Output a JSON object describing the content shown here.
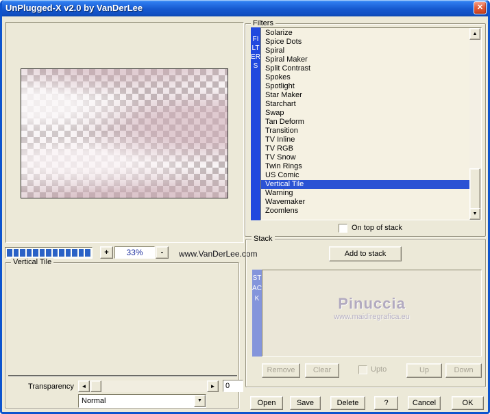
{
  "window": {
    "title": "UnPlugged-X v2.0 by VanDerLee"
  },
  "icons": {
    "close": "✕",
    "up_arrow": "▲",
    "down_arrow": "▼",
    "left_arrow": "◄",
    "right_arrow": "►"
  },
  "zoom_controls": {
    "plus_label": "+",
    "value": "33%",
    "minus_label": "-"
  },
  "progress": {
    "segments": 13
  },
  "branding": {
    "website": "www.VanDerLee.com"
  },
  "vt_group": {
    "label": "Vertical Tile",
    "transparency_label": "Transparency",
    "transparency_value": "0",
    "blend_mode": "Normal"
  },
  "filters": {
    "label": "Filters",
    "vertical_label": "FILTERS",
    "items": [
      "Solarize",
      "Spice Dots",
      "Spiral",
      "Spiral Maker",
      "Split Contrast",
      "Spokes",
      "Spotlight",
      "Star Maker",
      "Starchart",
      "Swap",
      "Tan Deform",
      "Transition",
      "TV Inline",
      "TV RGB",
      "TV Snow",
      "Twin Rings",
      "US Comic",
      "Vertical Tile",
      "Warning",
      "Wavemaker",
      "Zoomlens"
    ],
    "selected": "Vertical Tile",
    "on_top_label": "On top of stack",
    "on_top_checked": false
  },
  "stack": {
    "label": "Stack",
    "vertical_label": "STACK",
    "add_button": "Add to stack",
    "watermark_title": "Pinuccia",
    "watermark_url": "www.maidiregrafica.eu",
    "remove_button": "Remove",
    "clear_button": "Clear",
    "upto_label": "Upto",
    "upto_checked": false,
    "up_button": "Up",
    "down_button": "Down"
  },
  "footer": {
    "open": "Open",
    "save": "Save",
    "delete": "Delete",
    "help": "?",
    "cancel": "Cancel",
    "ok": "OK"
  },
  "colors": {
    "bg": "#ECE9D8",
    "frame": "#0D54CE",
    "title-mid": "#1659CF",
    "filters-bar": "#2149DE",
    "stack-bar": "#8495DB",
    "selection": "#2A52D4",
    "progress-seg": "#2A62C6",
    "field-cream": "#F5F1E2",
    "value-text": "#1D2F9E",
    "watermark": "#B2AAC0",
    "disabled-text": "#A7A395"
  }
}
